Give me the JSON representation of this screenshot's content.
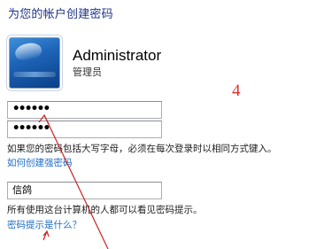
{
  "page": {
    "title": "为您的帐户创建密码"
  },
  "account": {
    "name": "Administrator",
    "role": "管理员",
    "avatar_icon": "user-tile-icon"
  },
  "step_label": "4",
  "fields": {
    "new_password": "••••••",
    "confirm_password": "••••••",
    "password_hint": "信鸽"
  },
  "notes": {
    "caps_lock": "如果您的密码包括大写字母，必须在每次登录时以相同方式键入。",
    "hint_visible": "所有使用这台计算机的人都可以看见密码提示。"
  },
  "links": {
    "strong_password": "如何创建强密码",
    "what_is_hint": "密码提示是什么？"
  },
  "colors": {
    "title": "#1e3287",
    "link": "#1c6bc7",
    "annotation": "#cc2222"
  }
}
